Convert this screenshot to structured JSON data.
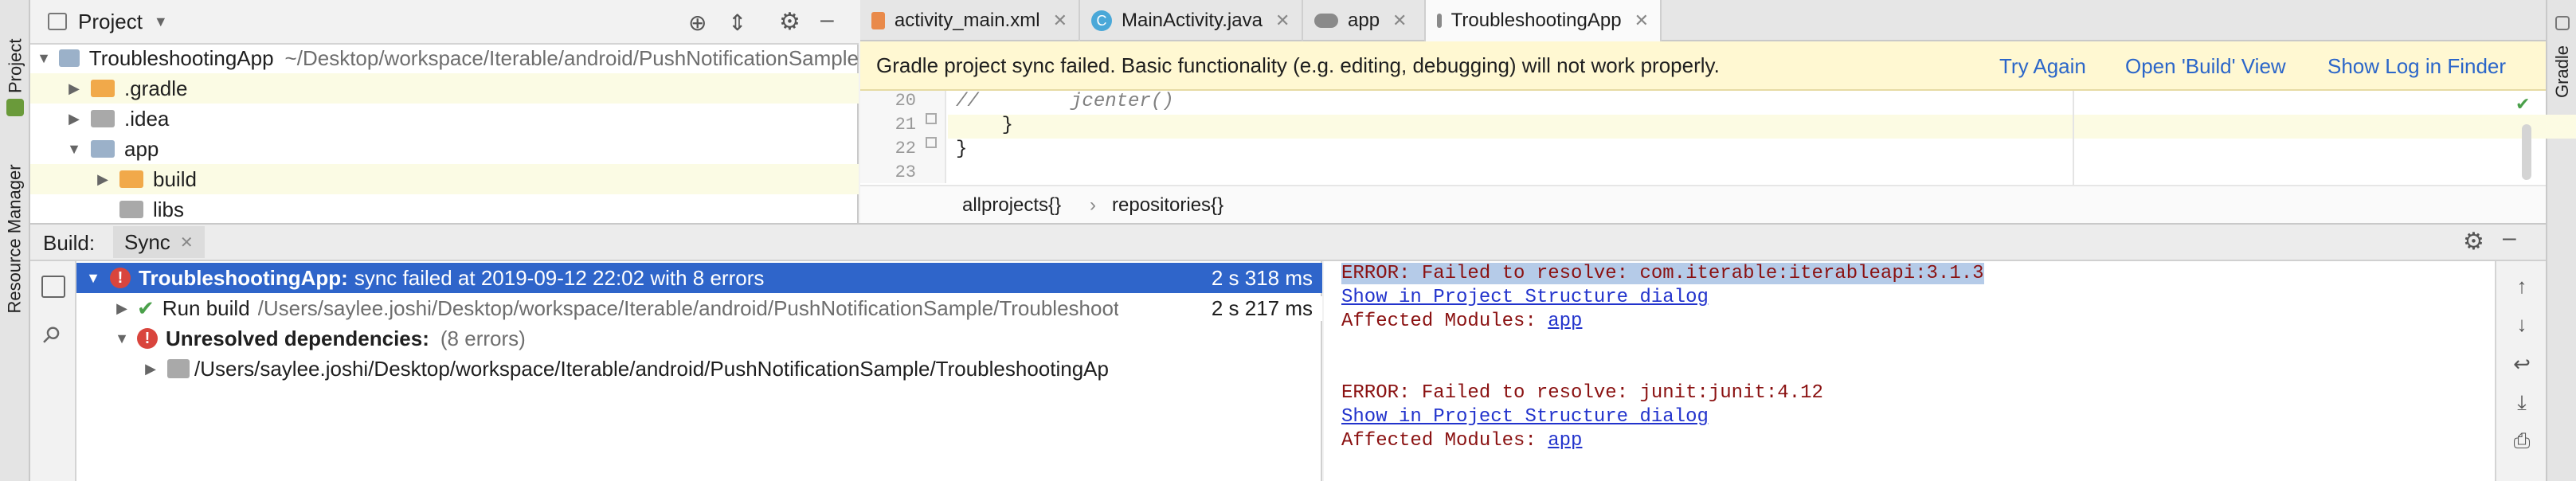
{
  "left_strip": {
    "project_tab": "1: Project",
    "resource_tab": "Resource Manager"
  },
  "right_strip": {
    "gradle_tab": "Gradle"
  },
  "project": {
    "header_title": "Project",
    "tree": [
      {
        "name": "TroubleshootingApp",
        "path": "~/Desktop/workspace/Iterable/android/PushNotificationSample",
        "expanded": true,
        "level": 0
      },
      {
        "name": ".gradle",
        "expanded": false,
        "level": 1
      },
      {
        "name": ".idea",
        "expanded": false,
        "level": 1
      },
      {
        "name": "app",
        "expanded": true,
        "level": 1
      },
      {
        "name": "build",
        "expanded": false,
        "level": 2
      },
      {
        "name": "libs",
        "expanded": false,
        "level": 2
      }
    ]
  },
  "editor": {
    "tabs": [
      {
        "label": "activity_main.xml",
        "active": false
      },
      {
        "label": "MainActivity.java",
        "active": false
      },
      {
        "label": "app",
        "active": false
      },
      {
        "label": "TroubleshootingApp",
        "active": true
      }
    ],
    "notification": {
      "message": "Gradle project sync failed. Basic functionality (e.g. editing, debugging) will not work properly.",
      "actions": [
        "Try Again",
        "Open 'Build' View",
        "Show Log in Finder"
      ]
    },
    "line_numbers": [
      "20",
      "21",
      "22",
      "23"
    ],
    "code_lines": [
      "//        jcenter()",
      "    }",
      "}",
      ""
    ],
    "breadcrumbs": [
      "allprojects{}",
      "repositories{}"
    ]
  },
  "build": {
    "label": "Build:",
    "tab": "Sync",
    "rows": [
      {
        "title": "TroubleshootingApp:",
        "detail": "sync failed at 2019-09-12 22:02  with 8 errors",
        "time": "2 s 318 ms"
      },
      {
        "title": "Run build",
        "detail": "/Users/saylee.joshi/Desktop/workspace/Iterable/android/PushNotificationSample/TroubleshootingApp",
        "time": "2 s 217 ms"
      },
      {
        "title": "Unresolved dependencies:",
        "detail": "(8 errors)",
        "time": ""
      },
      {
        "title": "",
        "detail": "/Users/saylee.joshi/Desktop/workspace/Iterable/android/PushNotificationSample/TroubleshootingAp",
        "time": ""
      }
    ],
    "console": {
      "error1": "ERROR: Failed to resolve: com.iterable:iterableapi:3.1.3",
      "link1": "Show in Project Structure dialog",
      "modules1_label": "Affected Modules: ",
      "modules1_value": "app",
      "error2": "ERROR: Failed to resolve: junit:junit:4.12",
      "link2": "Show in Project Structure dialog",
      "modules2_label": "Affected Modules: ",
      "modules2_value": "app"
    }
  },
  "colors": {
    "selection": "#2f65ca",
    "notif_bg": "#fff8d2",
    "link": "#2b66c9",
    "error": "#d9453d"
  }
}
